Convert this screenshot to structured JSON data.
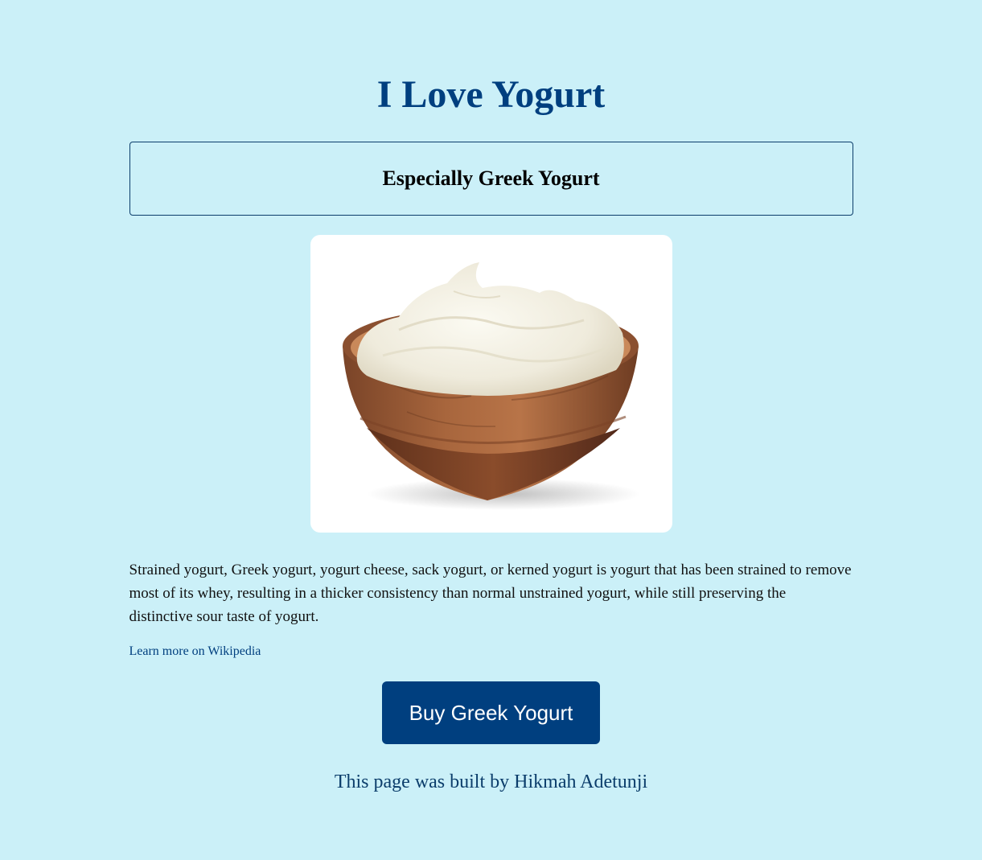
{
  "header": {
    "title": "I Love Yogurt",
    "subtitle": "Especially Greek Yogurt"
  },
  "image": {
    "subject": "yogurt-bowl-image",
    "background": "#ffffff"
  },
  "content": {
    "description": "Strained yogurt, Greek yogurt, yogurt cheese, sack yogurt, or kerned yogurt is yogurt that has been strained to remove most of its whey, resulting in a thicker consistency than normal unstrained yogurt, while still preserving the distinctive sour taste of yogurt.",
    "link_text": "Learn more on Wikipedia"
  },
  "cta": {
    "button_label": "Buy Greek Yogurt"
  },
  "footer": {
    "credit": "This page was built by Hikmah Adetunji"
  },
  "colors": {
    "page_background": "#cbf0f8",
    "primary": "#003f7f",
    "button_text": "#ffffff"
  }
}
